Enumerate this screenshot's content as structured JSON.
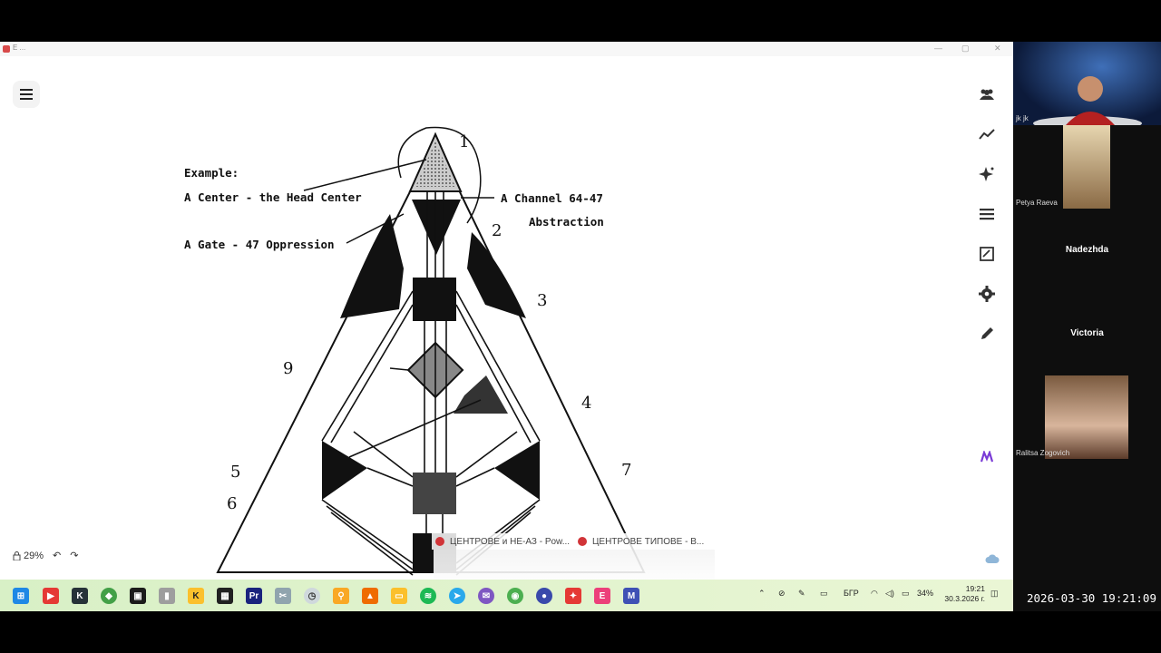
{
  "window": {
    "tab_title": "E ..."
  },
  "diagram": {
    "example_heading": "Example:",
    "center_label": "A Center - the Head Center",
    "gate_label": "A Gate - 47 Oppression",
    "channel_label": "A Channel 64-47",
    "channel_name": "Abstraction",
    "numbers": [
      "1",
      "2",
      "3",
      "9",
      "4",
      "5",
      "6",
      "7"
    ]
  },
  "toolbar_right": {
    "icons": [
      "participants-icon",
      "trend-icon",
      "sparkle-icon",
      "list-icon",
      "notes-icon",
      "settings-icon",
      "pen-icon"
    ]
  },
  "zoom": {
    "value": "29%"
  },
  "floating_tabs": [
    {
      "label": "ЦЕНТРОВЕ и НЕ-АЗ - Pow..."
    },
    {
      "label": "ЦЕНТРОВЕ ТИПОВЕ - В..."
    }
  ],
  "taskbar": {
    "tray_lang": "БГР",
    "battery": "34%",
    "time": "19:21",
    "date": "30.3.2026 г."
  },
  "participants": [
    {
      "name": "jk jk"
    },
    {
      "name": "Petya Raeva"
    },
    {
      "name": "Nadezhda"
    },
    {
      "name": "Victoria"
    },
    {
      "name": "Ralitsa Zogovich"
    }
  ],
  "timestamp": "2026-03-30 19:21:09",
  "colors": {
    "taskbar": "#dcefc8",
    "sidebar": "#0e0e0e",
    "accent_red": "#d13438"
  }
}
